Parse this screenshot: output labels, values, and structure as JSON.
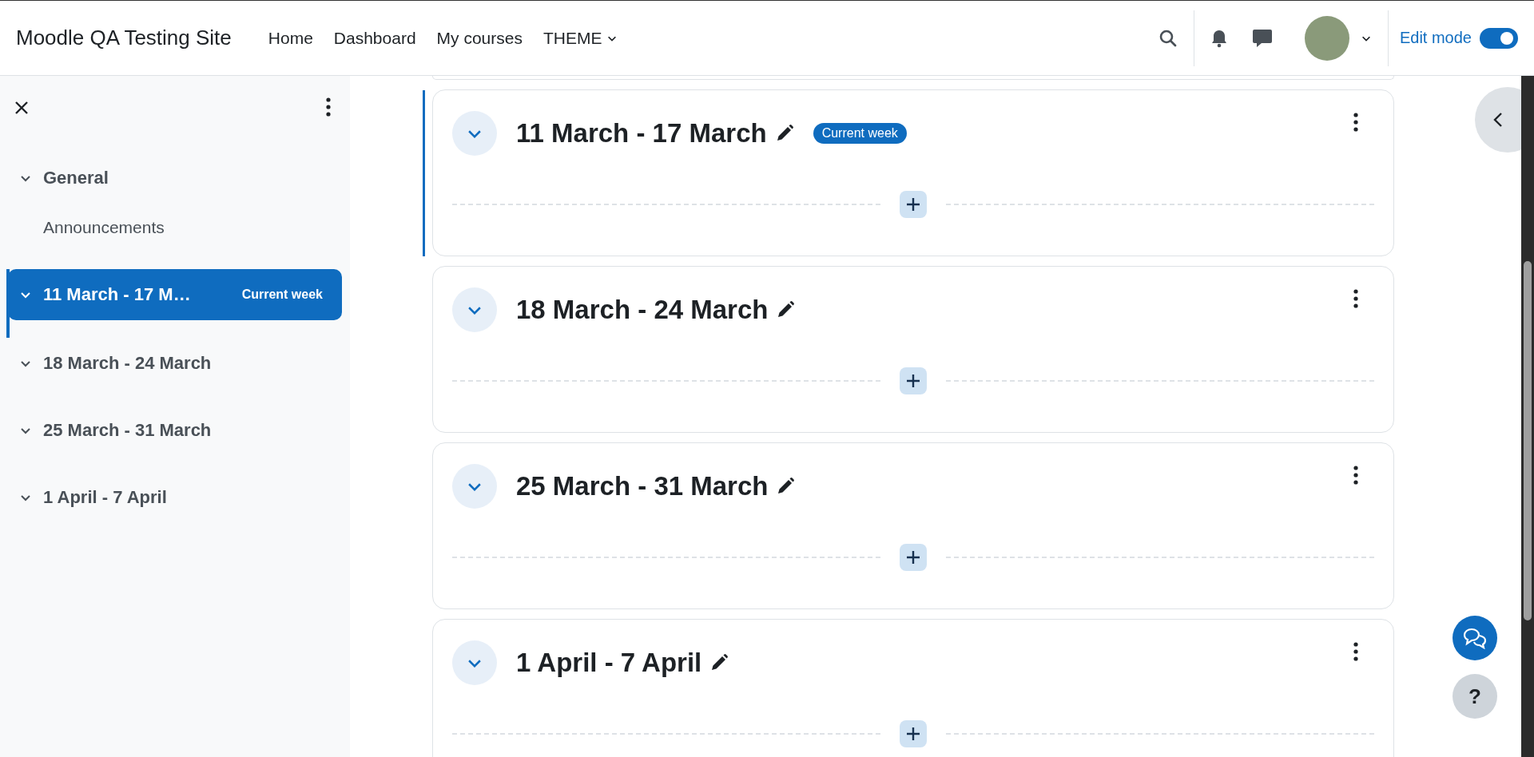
{
  "header": {
    "site_name": "Moodle QA Testing Site",
    "nav": [
      {
        "label": "Home",
        "dropdown": false
      },
      {
        "label": "Dashboard",
        "dropdown": false
      },
      {
        "label": "My courses",
        "dropdown": false
      },
      {
        "label": "THEME",
        "dropdown": true
      }
    ],
    "edit_mode": {
      "label": "Edit mode",
      "on": true
    }
  },
  "course_index": {
    "items": [
      {
        "title": "General",
        "selected": false,
        "children": [
          {
            "title": "Announcements"
          }
        ]
      },
      {
        "title": "11 March - 17 M…",
        "selected": true,
        "badge": "Current week"
      },
      {
        "title": "18 March - 24 March",
        "selected": false
      },
      {
        "title": "25 March - 31 March",
        "selected": false
      },
      {
        "title": "1 April - 7 April",
        "selected": false
      }
    ]
  },
  "sections": [
    {
      "title": "11 March - 17 March",
      "current": true,
      "badge": "Current week"
    },
    {
      "title": "18 March - 24 March",
      "current": false
    },
    {
      "title": "25 March - 31 March",
      "current": false
    },
    {
      "title": "1 April - 7 April",
      "current": false
    }
  ],
  "help_button": "?"
}
